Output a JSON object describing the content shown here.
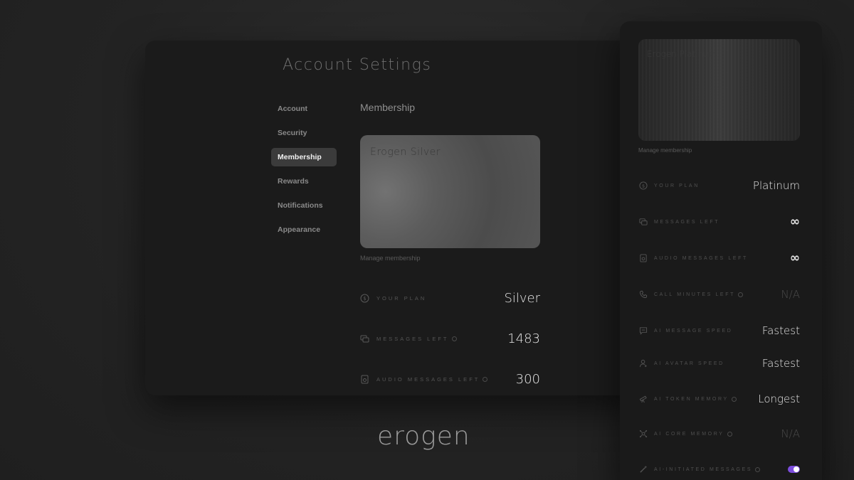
{
  "settings": {
    "title": "Account Settings",
    "nav": [
      {
        "label": "Account"
      },
      {
        "label": "Security"
      },
      {
        "label": "Membership",
        "active": true
      },
      {
        "label": "Rewards"
      },
      {
        "label": "Notifications"
      },
      {
        "label": "Appearance"
      }
    ],
    "section_title": "Membership",
    "card_name": "Erogen Silver",
    "manage_label": "Manage membership",
    "stats": [
      {
        "icon": "dollar-circle-icon",
        "label": "YOUR PLAN",
        "value": "Silver",
        "info": false
      },
      {
        "icon": "messages-icon",
        "label": "MESSAGES LEFT",
        "value": "1483",
        "info": true
      },
      {
        "icon": "audio-icon",
        "label": "AUDIO MESSAGES LEFT",
        "value": "300",
        "info": true
      }
    ]
  },
  "panel": {
    "card_name": "Erogen Platinum",
    "manage_label": "Manage membership",
    "stats": [
      {
        "icon": "dollar-circle-icon",
        "label": "YOUR PLAN",
        "value": "Platinum",
        "info": false
      },
      {
        "icon": "messages-icon",
        "label": "MESSAGES LEFT",
        "value": "∞",
        "info": false
      },
      {
        "icon": "audio-icon",
        "label": "AUDIO MESSAGES LEFT",
        "value": "∞",
        "info": false
      },
      {
        "icon": "phone-icon",
        "label": "CALL MINUTES LEFT",
        "value": "N/A",
        "info": true
      },
      {
        "icon": "chat-icon",
        "label": "AI MESSAGE SPEED",
        "value": "Fastest",
        "info": false
      },
      {
        "icon": "avatar-icon",
        "label": "AI AVATAR SPEED",
        "value": "Fastest",
        "info": false
      },
      {
        "icon": "telescope-icon",
        "label": "AI TOKEN MEMORY",
        "value": "Longest",
        "info": true
      },
      {
        "icon": "core-icon",
        "label": "AI CORE MEMORY",
        "value": "N/A",
        "info": true
      },
      {
        "icon": "wand-icon",
        "label": "AI-INITIATED MESSAGES",
        "toggle": true,
        "toggle_on": true,
        "info": true
      }
    ]
  },
  "brand": {
    "logo": "erogen",
    "accent": "#7c4dde"
  }
}
